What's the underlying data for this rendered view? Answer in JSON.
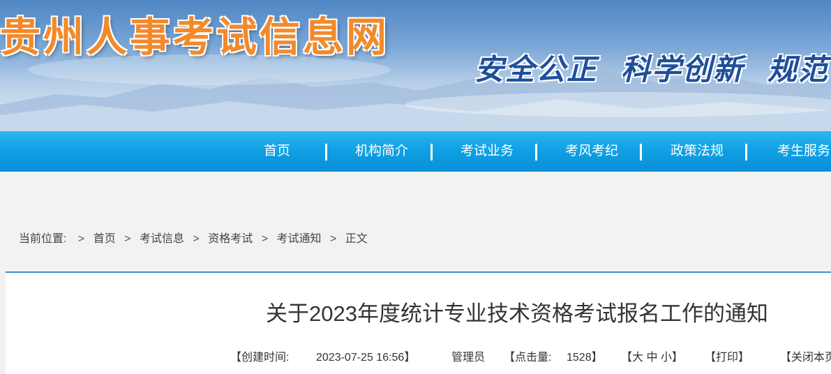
{
  "header": {
    "site_title": "贵州人事考试信息网",
    "slogan_1": "安全公正",
    "slogan_2": "科学创新",
    "slogan_3": "规范"
  },
  "nav": {
    "items": [
      {
        "label": "首页"
      },
      {
        "label": "机构简介"
      },
      {
        "label": "考试业务"
      },
      {
        "label": "考风考纪"
      },
      {
        "label": "政策法规"
      },
      {
        "label": "考生服务"
      }
    ]
  },
  "breadcrumb": {
    "prefix": "当前位置:",
    "sep": ">",
    "items": [
      "首页",
      "考试信息",
      "资格考试",
      "考试通知",
      "正文"
    ]
  },
  "article": {
    "title": "关于2023年度统计专业技术资格考试报名工作的通知",
    "created_label": "【创建时间:",
    "created_value": "2023-07-25 16:56】",
    "author": "管理员",
    "hits_label": "【点击量:",
    "hits_value": "1528】",
    "font_size": "【大 中 小】",
    "print": "【打印】",
    "close": "【关闭本页】"
  },
  "colors": {
    "nav_bg": "#10a1e4",
    "panel_border": "#3d8fd0",
    "title_orange": "#f28a2c",
    "slogan_blue": "#1f4f9a"
  }
}
